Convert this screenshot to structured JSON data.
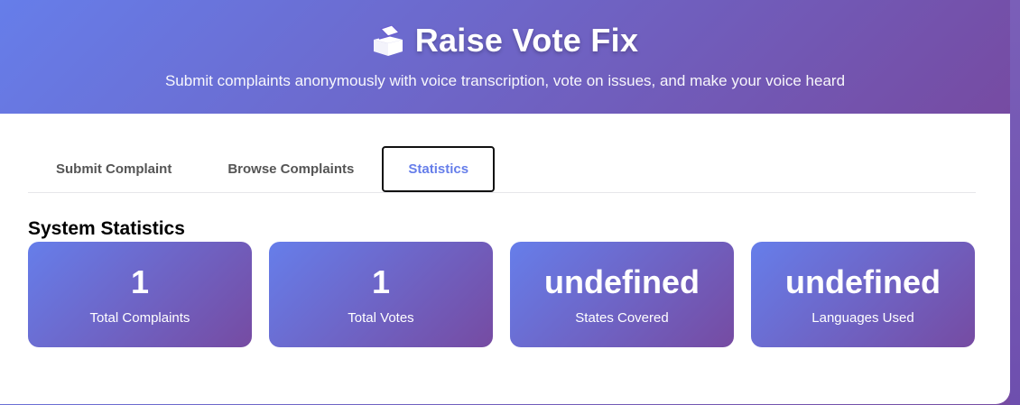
{
  "header": {
    "icon": "ballot-box-icon",
    "title": "Raise Vote Fix",
    "subtitle": "Submit complaints anonymously with voice transcription, vote on issues, and make your voice heard"
  },
  "tabs": [
    {
      "label": "Submit Complaint",
      "active": false
    },
    {
      "label": "Browse Complaints",
      "active": false
    },
    {
      "label": "Statistics",
      "active": true
    }
  ],
  "statistics": {
    "section_title": "System Statistics",
    "cards": [
      {
        "value": "1",
        "label": "Total Complaints"
      },
      {
        "value": "1",
        "label": "Total Votes"
      },
      {
        "value": "undefined",
        "label": "States Covered"
      },
      {
        "value": "undefined",
        "label": "Languages Used"
      }
    ]
  },
  "colors": {
    "gradient_start": "#667eea",
    "gradient_end": "#764ba2",
    "active_tab_text": "#667eea"
  }
}
